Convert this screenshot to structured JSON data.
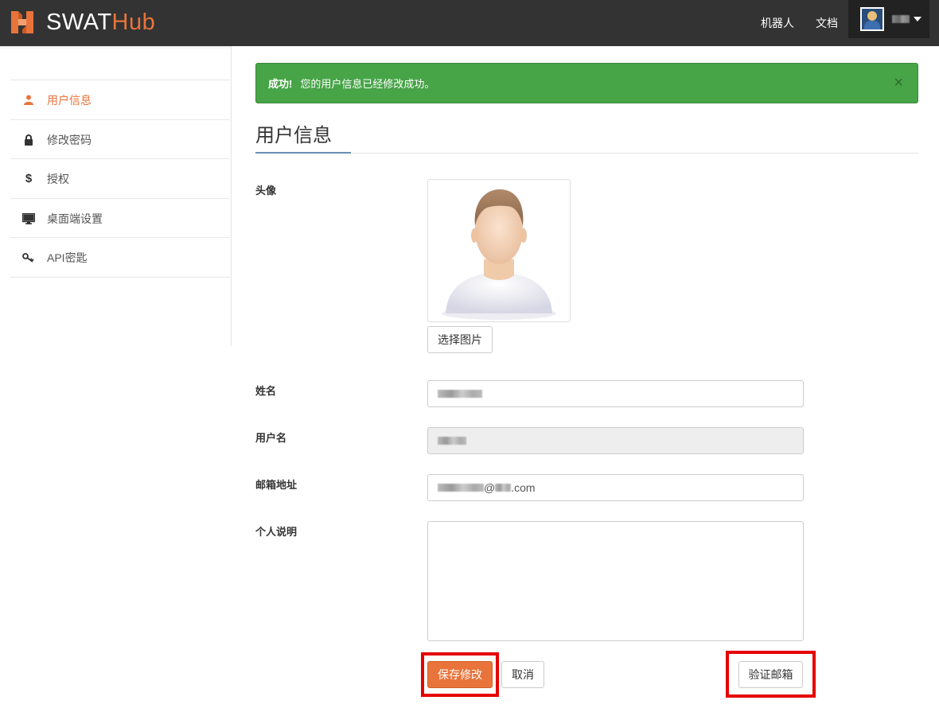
{
  "app": {
    "logo_text_1": "SWAT",
    "logo_text_2": "Hub",
    "brand_color": "#e8743b"
  },
  "topnav": {
    "robot": "机器人",
    "docs": "文档",
    "user_icon": "user-avatar",
    "menu_icon": "caret-down-icon"
  },
  "sidebar": {
    "items": [
      {
        "label": "用户信息",
        "icon": "user-icon",
        "active": true
      },
      {
        "label": "修改密码",
        "icon": "lock-icon",
        "active": false
      },
      {
        "label": "授权",
        "icon": "dollar-icon",
        "active": false
      },
      {
        "label": "桌面端设置",
        "icon": "monitor-icon",
        "active": false
      },
      {
        "label": "API密匙",
        "icon": "key-icon",
        "active": false
      }
    ]
  },
  "alert": {
    "strong": "成功!",
    "message": "您的用户信息已经修改成功。",
    "close": "×",
    "color": "#47a447"
  },
  "page": {
    "title": "用户信息"
  },
  "form": {
    "avatar_label": "头像",
    "choose_image": "选择图片",
    "name_label": "姓名",
    "username_label": "用户名",
    "email_label": "邮箱地址",
    "email_at": "@",
    "email_suffix": ".com",
    "bio_label": "个人说明",
    "bio_value": "",
    "save": "保存修改",
    "cancel": "取消",
    "verify_email": "验证邮箱"
  }
}
